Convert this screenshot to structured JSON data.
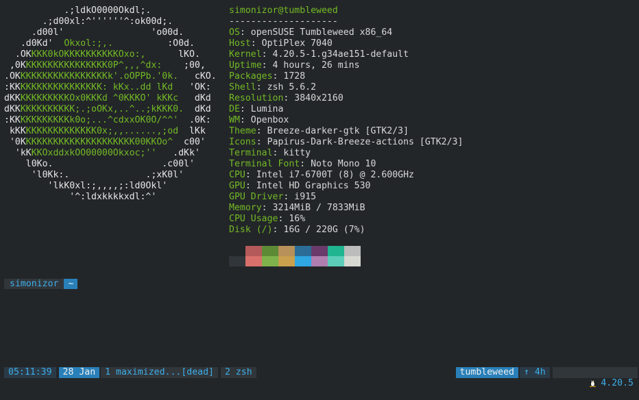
{
  "logo": {
    "lines": [
      [
        [
          "w",
          "           .;ldkO0000Okdl;."
        ]
      ],
      [
        [
          "w",
          "       .;d00xl:^''''''^:ok00d;."
        ]
      ],
      [
        [
          "w",
          "     .d00l'                'o00d."
        ]
      ],
      [
        [
          "w",
          "   .d0Kd'  "
        ],
        [
          "g",
          "Okxol:;,."
        ],
        [
          "w",
          "          :O0d."
        ]
      ],
      [
        [
          "w",
          "  .OK"
        ],
        [
          "g",
          "KKK0kOKKKKKKKKKKOxo:,"
        ],
        [
          "w",
          "      lKO."
        ]
      ],
      [
        [
          "w",
          " ,0K"
        ],
        [
          "g",
          "KKKKKKKKKKKKKKK0P^,,,^dx:"
        ],
        [
          "w",
          "    ;00,"
        ]
      ],
      [
        [
          "w",
          ".OK"
        ],
        [
          "g",
          "KKKKKKKKKKKKKKKKk'.oOPPb.'0k."
        ],
        [
          "w",
          "   cKO."
        ]
      ],
      [
        [
          "w",
          ":KK"
        ],
        [
          "g",
          "KKKKKKKKKKKKKKK: kKx..dd lKd"
        ],
        [
          "w",
          "   'OK:"
        ]
      ],
      [
        [
          "w",
          "dKK"
        ],
        [
          "g",
          "KKKKKKKKKOx0KKKd ^0KKKO' kKKc"
        ],
        [
          "w",
          "   dKd"
        ]
      ],
      [
        [
          "w",
          "dKK"
        ],
        [
          "g",
          "KKKKKKKKKK;.;oOKx,..^..;kKKK0."
        ],
        [
          "w",
          "  dKd"
        ]
      ],
      [
        [
          "w",
          ":KK"
        ],
        [
          "g",
          "KKKKKKKKKk0o;...^cdxxOK0O/^^'"
        ],
        [
          "w",
          "  .0K:"
        ]
      ],
      [
        [
          "w",
          " kKK"
        ],
        [
          "g",
          "KKKKKKKKKKKKK0x;,,......,;od"
        ],
        [
          "w",
          "  lKk"
        ]
      ],
      [
        [
          "w",
          " '0K"
        ],
        [
          "g",
          "KKKKKKKKKKKKKKKKKKKK00KKOo^"
        ],
        [
          "w",
          "  c00'"
        ]
      ],
      [
        [
          "w",
          "  'kK"
        ],
        [
          "g",
          "KKOxddxkOO00000Okxoc;''"
        ],
        [
          "w",
          "   .dKk'"
        ]
      ],
      [
        [
          "w",
          "    l0Ko.                    .c00l'"
        ]
      ],
      [
        [
          "w",
          "     'l0Kk:.              .;xK0l'"
        ]
      ],
      [
        [
          "w",
          "        'lkK0xl:;,,,,;:ld0Okl'"
        ]
      ],
      [
        [
          "w",
          "            '^:ldxkkkkxdl:^'"
        ]
      ]
    ]
  },
  "info": {
    "header": "simonizor@tumbleweed",
    "separator": "--------------------",
    "rows": [
      {
        "key": "OS",
        "value": "openSUSE Tumbleweed x86_64"
      },
      {
        "key": "Host",
        "value": "OptiPlex 7040"
      },
      {
        "key": "Kernel",
        "value": "4.20.5-1.g34ae151-default"
      },
      {
        "key": "Uptime",
        "value": "4 hours, 26 mins"
      },
      {
        "key": "Packages",
        "value": "1728"
      },
      {
        "key": "Shell",
        "value": "zsh 5.6.2"
      },
      {
        "key": "Resolution",
        "value": "3840x2160"
      },
      {
        "key": "DE",
        "value": "Lumina"
      },
      {
        "key": "WM",
        "value": "Openbox"
      },
      {
        "key": "Theme",
        "value": "Breeze-darker-gtk [GTK2/3]"
      },
      {
        "key": "Icons",
        "value": "Papirus-Dark-Breeze-actions [GTK2/3]"
      },
      {
        "key": "Terminal",
        "value": "kitty"
      },
      {
        "key": "Terminal Font",
        "value": "Noto Mono 10"
      },
      {
        "key": "CPU",
        "value": "Intel i7-6700T (8) @ 2.600GHz"
      },
      {
        "key": "GPU",
        "value": "Intel HD Graphics 530"
      },
      {
        "key": "GPU Driver",
        "value": "i915"
      },
      {
        "key": "Memory",
        "value": "3214MiB / 7833MiB"
      },
      {
        "key": "CPU Usage",
        "value": "16%"
      },
      {
        "key": "Disk (/)",
        "value": "16G / 220G (7%)"
      }
    ]
  },
  "palette": {
    "normal": [
      "#232629",
      "#b55a5a",
      "#5d8a35",
      "#b8905a",
      "#2b6d96",
      "#6a3a6a",
      "#1fb590",
      "#bcbcbc"
    ],
    "bright": [
      "#31363b",
      "#d9706b",
      "#7fb24b",
      "#c9a04e",
      "#2ea7e3",
      "#b07fb0",
      "#5ccdb8",
      "#d8d8d2"
    ]
  },
  "prompt": {
    "user": "simonizor",
    "dir": "~"
  },
  "statusbar": {
    "time": "05:11:39",
    "date": "28 Jan",
    "window1": "1 maximized...[dead]",
    "window2": "2 zsh",
    "host": "tumbleweed",
    "uptime": "↑ 4h",
    "kernel": "4.20.5",
    "kernel_icon": "tux-icon"
  }
}
